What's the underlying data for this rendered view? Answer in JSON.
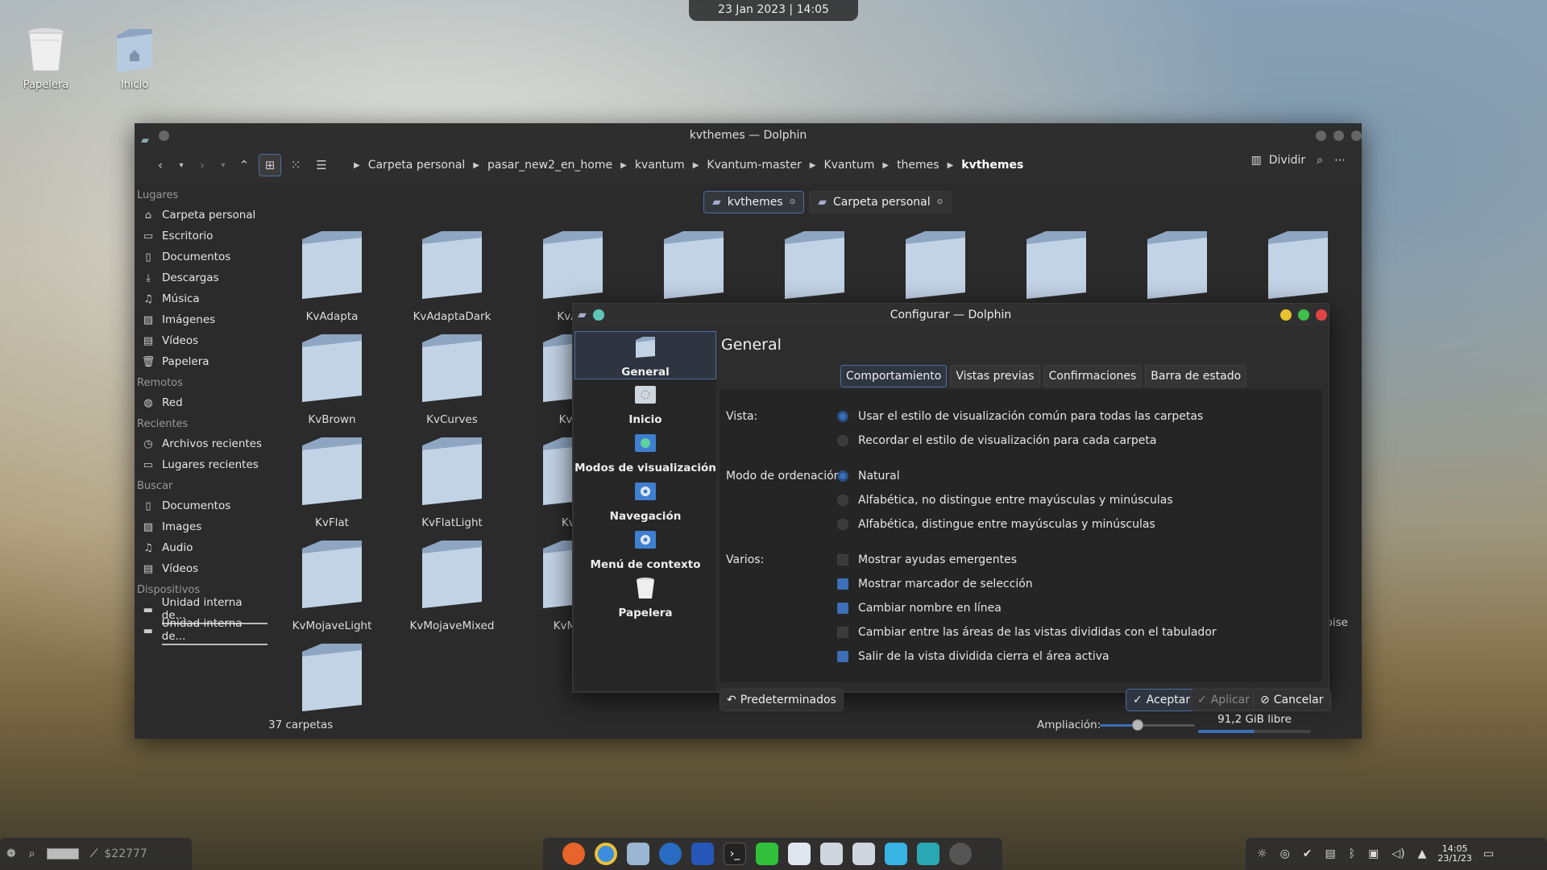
{
  "topbar": {
    "datetime": "23 Jan 2023 | 14:05"
  },
  "desktop": {
    "icons": [
      {
        "label": "Papelera"
      },
      {
        "label": "Inicio"
      }
    ]
  },
  "dolphin": {
    "title": "kvthemes — Dolphin",
    "breadcrumb": [
      "Carpeta personal",
      "pasar_new2_en_home",
      "kvantum",
      "Kvantum-master",
      "Kvantum",
      "themes",
      "kvthemes"
    ],
    "split_label": "Dividir",
    "tabs": [
      "kvthemes",
      "Carpeta personal"
    ],
    "sidebar": {
      "lugares_head": "Lugares",
      "lugares": [
        "Carpeta personal",
        "Escritorio",
        "Documentos",
        "Descargas",
        "Música",
        "Imágenes",
        "Vídeos",
        "Papelera"
      ],
      "remotos_head": "Remotos",
      "remotos": [
        "Red"
      ],
      "recientes_head": "Recientes",
      "recientes": [
        "Archivos recientes",
        "Lugares recientes"
      ],
      "buscar_head": "Buscar",
      "buscar": [
        "Documentos",
        "Images",
        "Audio",
        "Vídeos"
      ],
      "dispositivos_head": "Dispositivos",
      "dispositivos": [
        "Unidad interna de...",
        "Unidad interna de..."
      ]
    },
    "folders": [
      "KvAdapta",
      "KvAdaptaDark",
      "KvAm",
      "KvBrown",
      "KvCurves",
      "KvCu",
      "KvFlat",
      "KvFlatLight",
      "KvFl",
      "KvMojaveLight",
      "KvMojaveMixed",
      "KvMoja",
      "oise"
    ],
    "status": {
      "count": "37 carpetas",
      "zoom_label": "Ampliación:",
      "zoom_level": 0.4,
      "free_space": "91,2 GiB libre",
      "used_fraction": 0.5
    }
  },
  "dialog": {
    "title": "Configurar — Dolphin",
    "categories": [
      "General",
      "Inicio",
      "Modos de visualización",
      "Navegación",
      "Menú de contexto",
      "Papelera"
    ],
    "heading": "General",
    "tabs": [
      "Comportamiento",
      "Vistas previas",
      "Confirmaciones",
      "Barra de estado"
    ],
    "vista_label": "Vista:",
    "vista_options": [
      "Usar el estilo de visualización común para todas las carpetas",
      "Recordar el estilo de visualización para cada carpeta"
    ],
    "orden_label": "Modo de ordenación:",
    "orden_options": [
      "Natural",
      "Alfabética, no distingue entre mayúsculas y minúsculas",
      "Alfabética, distingue entre mayúsculas y minúsculas"
    ],
    "varios_label": "Varios:",
    "varios_options": [
      "Mostrar ayudas emergentes",
      "Mostrar marcador de selección",
      "Cambiar nombre en línea",
      "Cambiar entre las áreas de las vistas divididas con el tabulador",
      "Salir de la vista dividida cierra el área activa"
    ],
    "varios_checked": [
      false,
      true,
      true,
      false,
      true
    ],
    "btn_defaults": "Predeterminados",
    "btn_ok": "Aceptar",
    "btn_apply": "Aplicar",
    "btn_cancel": "Cancelar"
  },
  "taskbar": {
    "counter": "$22777",
    "clock_time": "14:05",
    "clock_date": "23/1/23"
  }
}
